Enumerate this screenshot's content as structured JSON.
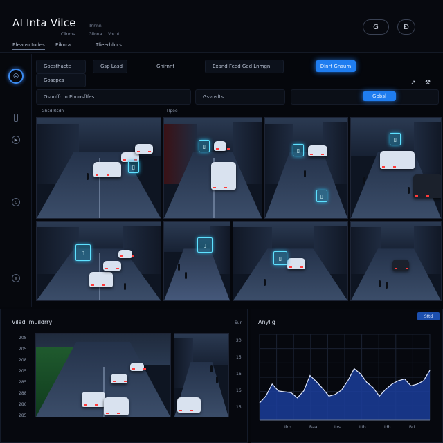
{
  "header": {
    "app_title": "AI Inta Vilce",
    "small_labels": [
      "Ilnnnn",
      "Giinna",
      "Vocutt",
      "Clinms"
    ],
    "tabs": [
      "Pfeausctudes",
      "Eiknra",
      "Tlieerhhics"
    ],
    "round_buttons": [
      "G",
      "Đ"
    ]
  },
  "toolbar": {
    "left_tabs": [
      "Goesfhacte",
      "Goscpes"
    ],
    "chips": [
      "Gsp Lasd",
      "Gnirnnt",
      "Exand Feed Ged Lnmgn"
    ],
    "primary_button": "Dlnrt Gnsum",
    "row_left": "Gsunffrtin Phuosfffes",
    "row_mid": "Gsvnsfts",
    "row_button": "Gpbsl"
  },
  "rail": {
    "icons": [
      "logo-icon",
      "stream-icon",
      "play-icon",
      "history-icon",
      "settings-icon"
    ]
  },
  "grid": {
    "labels": [
      "Ghsd Rsdh",
      "Tlpee"
    ],
    "feeds": [
      {
        "name": "feed-1",
        "tags": 1
      },
      {
        "name": "feed-2",
        "tags": 1
      },
      {
        "name": "feed-3",
        "tags": 2
      },
      {
        "name": "feed-4",
        "tags": 1
      },
      {
        "name": "feed-5",
        "tags": 1
      },
      {
        "name": "feed-6",
        "tags": 1
      },
      {
        "name": "feed-7",
        "tags": 1
      },
      {
        "name": "feed-8",
        "tags": 0
      }
    ]
  },
  "bottom_left": {
    "title": "Vilad Imuildrry",
    "side_label": "Sur",
    "y_ticks_left": [
      "208",
      "205",
      "208",
      "205",
      "285",
      "288",
      "286",
      "285"
    ],
    "y_ticks_right": [
      "20",
      "15",
      "16",
      "16",
      "15"
    ]
  },
  "chart": {
    "title": "Anylig",
    "badge": "Sttd",
    "x_ticks": [
      "Ilrp",
      "Baa",
      "Ilrs",
      "Iltb",
      "Idb",
      "Bri"
    ]
  },
  "chart_data": {
    "type": "area",
    "title": "Anylig",
    "x": [
      "Ilrp",
      "Baa",
      "Ilrs",
      "Iltb",
      "Idb",
      "Bri"
    ],
    "values": [
      20,
      28,
      42,
      34,
      33,
      32,
      26,
      34,
      52,
      45,
      37,
      28,
      30,
      35,
      46,
      60,
      54,
      44,
      38,
      28,
      36,
      42,
      46,
      48,
      40,
      42,
      46,
      58
    ],
    "ylim": [
      0,
      100
    ],
    "color": "#1b3d9a",
    "line_color": "#dfe8ff",
    "grid": true
  },
  "colors": {
    "accent": "#1f7df0",
    "tag": "#5fe1ff"
  }
}
